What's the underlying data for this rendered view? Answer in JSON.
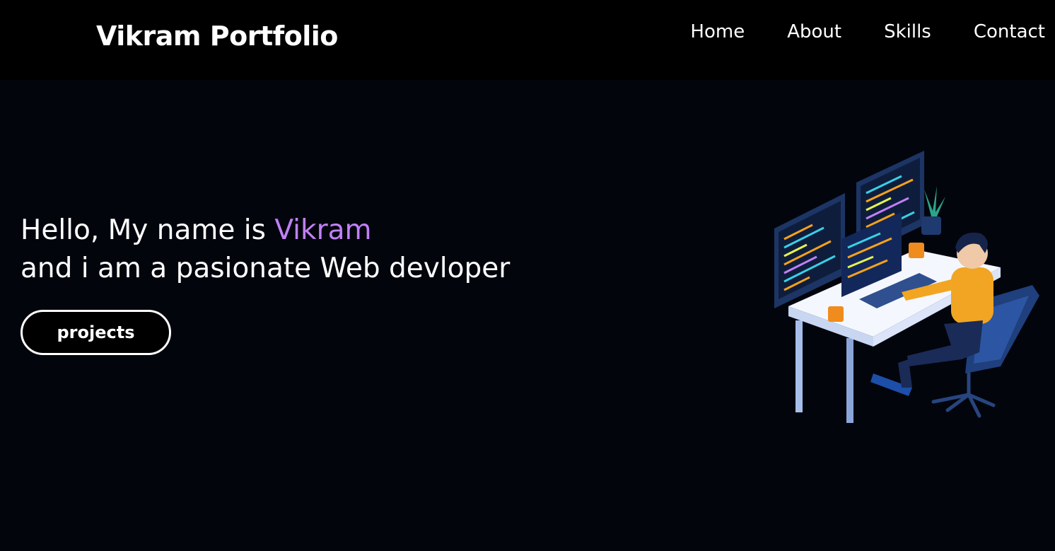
{
  "header": {
    "brand": "Vikram Portfolio",
    "nav": [
      {
        "label": "Home"
      },
      {
        "label": "About"
      },
      {
        "label": "Skills"
      },
      {
        "label": "Contact"
      }
    ]
  },
  "hero": {
    "line1_prefix": "Hello, My name is ",
    "line1_name": "Vikram",
    "line2": "and i am a pasionate Web devloper",
    "projects_button": "projects",
    "illustration_icon": "developer-at-desk-illustration"
  },
  "colors": {
    "page_background": "#03050d",
    "navbar_background": "#000000",
    "accent": "#c180f7",
    "text": "#ffffff"
  }
}
